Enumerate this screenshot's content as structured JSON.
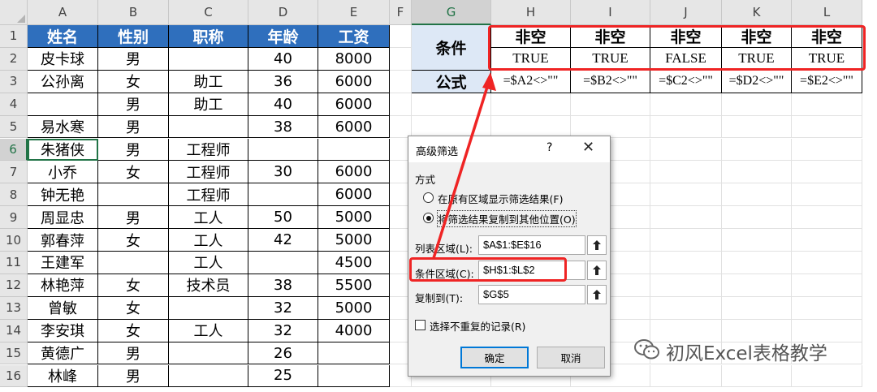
{
  "column_headers": [
    "A",
    "B",
    "C",
    "D",
    "E",
    "F",
    "G",
    "H",
    "I",
    "J",
    "K",
    "L"
  ],
  "row_headers": [
    "1",
    "2",
    "3",
    "4",
    "5",
    "6",
    "7",
    "8",
    "9",
    "10",
    "11",
    "12",
    "13",
    "14",
    "15",
    "16"
  ],
  "table": {
    "headers": [
      "姓名",
      "性别",
      "职称",
      "年龄",
      "工资"
    ],
    "rows": [
      [
        "皮卡球",
        "男",
        "",
        "40",
        "8000"
      ],
      [
        "公孙离",
        "女",
        "助工",
        "36",
        "6000"
      ],
      [
        "",
        "男",
        "助工",
        "40",
        "6000"
      ],
      [
        "易水寒",
        "男",
        "",
        "38",
        "6000"
      ],
      [
        "朱猪侠",
        "男",
        "工程师",
        "",
        ""
      ],
      [
        "小乔",
        "女",
        "工程师",
        "30",
        "6000"
      ],
      [
        "钟无艳",
        "",
        "工程师",
        "",
        "6000"
      ],
      [
        "周显忠",
        "男",
        "工人",
        "50",
        "5000"
      ],
      [
        "郭春萍",
        "女",
        "工人",
        "42",
        "5000"
      ],
      [
        "王建军",
        "",
        "工人",
        "",
        "4500"
      ],
      [
        "林艳萍",
        "女",
        "技术员",
        "38",
        "5500"
      ],
      [
        "曾敏",
        "女",
        "",
        "32",
        "5000"
      ],
      [
        "李安琪",
        "女",
        "工人",
        "32",
        "4000"
      ],
      [
        "黄德广",
        "男",
        "",
        "26",
        ""
      ],
      [
        "林峰",
        "男",
        "",
        "25",
        ""
      ]
    ]
  },
  "criteria": {
    "label": "条件",
    "formula_label": "公式",
    "headers": [
      "非空",
      "非空",
      "非空",
      "非空",
      "非空"
    ],
    "values": [
      "TRUE",
      "TRUE",
      "FALSE",
      "TRUE",
      "TRUE"
    ],
    "formulas": [
      "=$A2<>\"\"",
      "=$B2<>\"\"",
      "=$C2<>\"\"",
      "=$D2<>\"\"",
      "=$E2<>\"\""
    ]
  },
  "dialog": {
    "title": "高级筛选",
    "help": "?",
    "close": "✕",
    "method_label": "方式",
    "option_in_place": "在原有区域显示筛选结果(F)",
    "option_copy": "将筛选结果复制到其他位置(O)",
    "list_range_label": "列表区域(L):",
    "list_range_value": "$A$1:$E$16",
    "criteria_range_label": "条件区域(C):",
    "criteria_range_value": "$H$1:$L$2",
    "copy_to_label": "复制到(T):",
    "copy_to_value": "$G$5",
    "unique_label": "选择不重复的记录(R)",
    "ok_label": "确定",
    "cancel_label": "取消"
  },
  "watermark": {
    "text": "初风Excel表格教学",
    "icon": "wechat-icon"
  },
  "colors": {
    "table_header": "#2f6fbd",
    "criteria_label_bg": "#dde8f6",
    "highlight": "#ef2424",
    "excel_green": "#217346"
  }
}
